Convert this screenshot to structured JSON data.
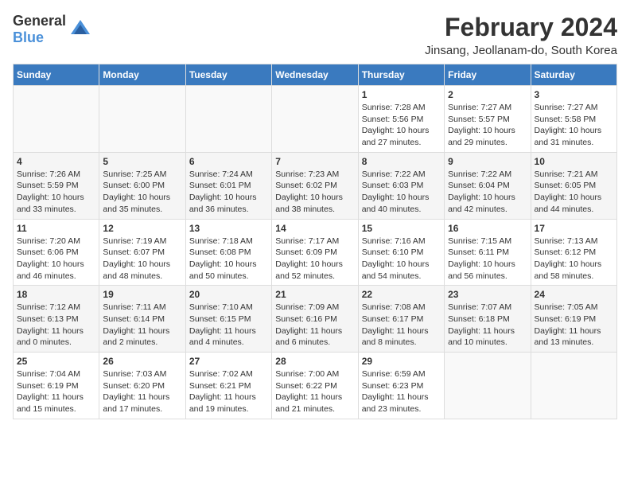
{
  "header": {
    "logo_general": "General",
    "logo_blue": "Blue",
    "month_title": "February 2024",
    "location": "Jinsang, Jeollanam-do, South Korea"
  },
  "days_of_week": [
    "Sunday",
    "Monday",
    "Tuesday",
    "Wednesday",
    "Thursday",
    "Friday",
    "Saturday"
  ],
  "weeks": [
    [
      {
        "day": "",
        "info": ""
      },
      {
        "day": "",
        "info": ""
      },
      {
        "day": "",
        "info": ""
      },
      {
        "day": "",
        "info": ""
      },
      {
        "day": "1",
        "info": "Sunrise: 7:28 AM\nSunset: 5:56 PM\nDaylight: 10 hours and 27 minutes."
      },
      {
        "day": "2",
        "info": "Sunrise: 7:27 AM\nSunset: 5:57 PM\nDaylight: 10 hours and 29 minutes."
      },
      {
        "day": "3",
        "info": "Sunrise: 7:27 AM\nSunset: 5:58 PM\nDaylight: 10 hours and 31 minutes."
      }
    ],
    [
      {
        "day": "4",
        "info": "Sunrise: 7:26 AM\nSunset: 5:59 PM\nDaylight: 10 hours and 33 minutes."
      },
      {
        "day": "5",
        "info": "Sunrise: 7:25 AM\nSunset: 6:00 PM\nDaylight: 10 hours and 35 minutes."
      },
      {
        "day": "6",
        "info": "Sunrise: 7:24 AM\nSunset: 6:01 PM\nDaylight: 10 hours and 36 minutes."
      },
      {
        "day": "7",
        "info": "Sunrise: 7:23 AM\nSunset: 6:02 PM\nDaylight: 10 hours and 38 minutes."
      },
      {
        "day": "8",
        "info": "Sunrise: 7:22 AM\nSunset: 6:03 PM\nDaylight: 10 hours and 40 minutes."
      },
      {
        "day": "9",
        "info": "Sunrise: 7:22 AM\nSunset: 6:04 PM\nDaylight: 10 hours and 42 minutes."
      },
      {
        "day": "10",
        "info": "Sunrise: 7:21 AM\nSunset: 6:05 PM\nDaylight: 10 hours and 44 minutes."
      }
    ],
    [
      {
        "day": "11",
        "info": "Sunrise: 7:20 AM\nSunset: 6:06 PM\nDaylight: 10 hours and 46 minutes."
      },
      {
        "day": "12",
        "info": "Sunrise: 7:19 AM\nSunset: 6:07 PM\nDaylight: 10 hours and 48 minutes."
      },
      {
        "day": "13",
        "info": "Sunrise: 7:18 AM\nSunset: 6:08 PM\nDaylight: 10 hours and 50 minutes."
      },
      {
        "day": "14",
        "info": "Sunrise: 7:17 AM\nSunset: 6:09 PM\nDaylight: 10 hours and 52 minutes."
      },
      {
        "day": "15",
        "info": "Sunrise: 7:16 AM\nSunset: 6:10 PM\nDaylight: 10 hours and 54 minutes."
      },
      {
        "day": "16",
        "info": "Sunrise: 7:15 AM\nSunset: 6:11 PM\nDaylight: 10 hours and 56 minutes."
      },
      {
        "day": "17",
        "info": "Sunrise: 7:13 AM\nSunset: 6:12 PM\nDaylight: 10 hours and 58 minutes."
      }
    ],
    [
      {
        "day": "18",
        "info": "Sunrise: 7:12 AM\nSunset: 6:13 PM\nDaylight: 11 hours and 0 minutes."
      },
      {
        "day": "19",
        "info": "Sunrise: 7:11 AM\nSunset: 6:14 PM\nDaylight: 11 hours and 2 minutes."
      },
      {
        "day": "20",
        "info": "Sunrise: 7:10 AM\nSunset: 6:15 PM\nDaylight: 11 hours and 4 minutes."
      },
      {
        "day": "21",
        "info": "Sunrise: 7:09 AM\nSunset: 6:16 PM\nDaylight: 11 hours and 6 minutes."
      },
      {
        "day": "22",
        "info": "Sunrise: 7:08 AM\nSunset: 6:17 PM\nDaylight: 11 hours and 8 minutes."
      },
      {
        "day": "23",
        "info": "Sunrise: 7:07 AM\nSunset: 6:18 PM\nDaylight: 11 hours and 10 minutes."
      },
      {
        "day": "24",
        "info": "Sunrise: 7:05 AM\nSunset: 6:19 PM\nDaylight: 11 hours and 13 minutes."
      }
    ],
    [
      {
        "day": "25",
        "info": "Sunrise: 7:04 AM\nSunset: 6:19 PM\nDaylight: 11 hours and 15 minutes."
      },
      {
        "day": "26",
        "info": "Sunrise: 7:03 AM\nSunset: 6:20 PM\nDaylight: 11 hours and 17 minutes."
      },
      {
        "day": "27",
        "info": "Sunrise: 7:02 AM\nSunset: 6:21 PM\nDaylight: 11 hours and 19 minutes."
      },
      {
        "day": "28",
        "info": "Sunrise: 7:00 AM\nSunset: 6:22 PM\nDaylight: 11 hours and 21 minutes."
      },
      {
        "day": "29",
        "info": "Sunrise: 6:59 AM\nSunset: 6:23 PM\nDaylight: 11 hours and 23 minutes."
      },
      {
        "day": "",
        "info": ""
      },
      {
        "day": "",
        "info": ""
      }
    ]
  ]
}
